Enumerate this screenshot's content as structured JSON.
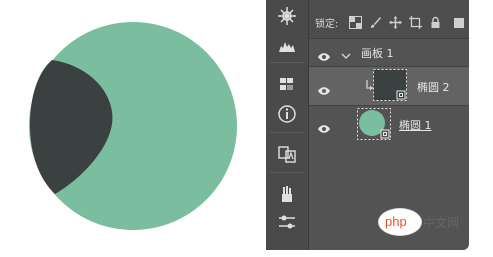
{
  "lock": {
    "label": "锁定:"
  },
  "layers": [
    {
      "name": "画板 1",
      "kind": "artboard"
    },
    {
      "name": "椭圆 2",
      "kind": "shape"
    },
    {
      "name": "椭圆 1",
      "kind": "shape"
    }
  ],
  "watermark": {
    "logo_text": "php",
    "site_name": "中文网"
  },
  "colors": {
    "circle_fill": "#7abd9f",
    "crescent_fill": "#3b4141",
    "panel_bg": "#535353",
    "toolbar_bg": "#4a4a4a",
    "selected_row": "#636363",
    "logo_orange": "#e8542a"
  }
}
